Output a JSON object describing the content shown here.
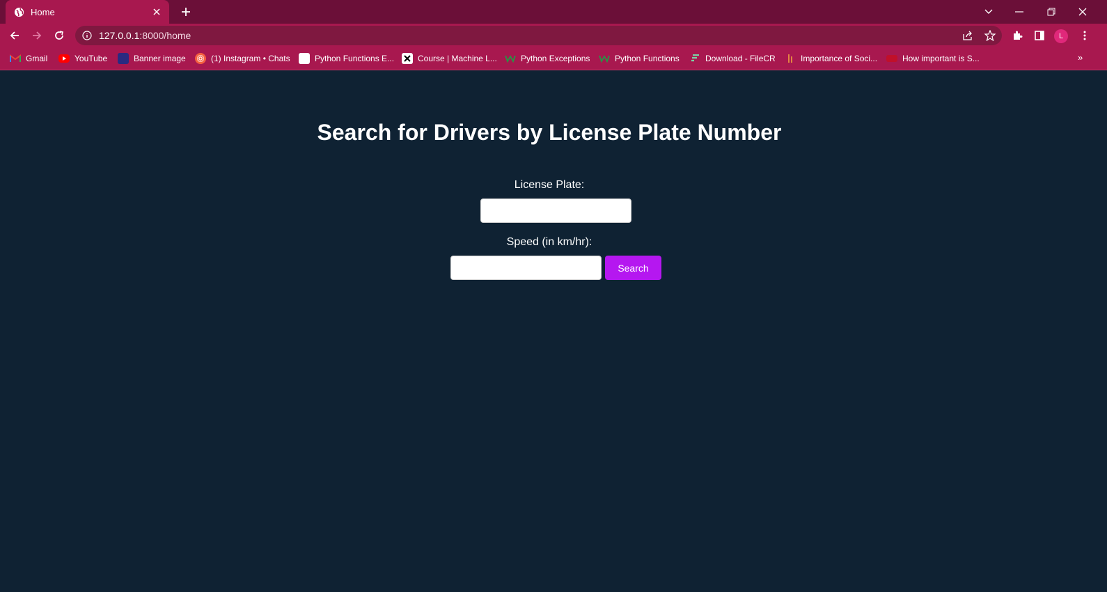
{
  "browser": {
    "tab": {
      "title": "Home"
    },
    "url": {
      "host": "127.0.0.1",
      "path": ":8000/home"
    },
    "avatar_initial": "L",
    "bookmarks": [
      {
        "label": "Gmail",
        "icon": "gmail-icon"
      },
      {
        "label": "YouTube",
        "icon": "youtube-icon"
      },
      {
        "label": "Banner image",
        "icon": "banner-icon"
      },
      {
        "label": "(1) Instagram • Chats",
        "icon": "instagram-icon"
      },
      {
        "label": "Python Functions E...",
        "icon": "python-functions-icon"
      },
      {
        "label": "Course | Machine L...",
        "icon": "x-icon"
      },
      {
        "label": "Python Exceptions",
        "icon": "w3-icon"
      },
      {
        "label": "Python Functions",
        "icon": "w3-icon"
      },
      {
        "label": "Download - FileCR",
        "icon": "filecr-icon"
      },
      {
        "label": "Importance of Soci...",
        "icon": "bar-icon"
      },
      {
        "label": "How important is S...",
        "icon": "red-site-icon"
      }
    ],
    "bookmarks_more": "»"
  },
  "page": {
    "heading": "Search for Drivers by License Plate Number",
    "license_label": "License Plate:",
    "license_value": "",
    "speed_label": "Speed (in km/hr):",
    "speed_value": "",
    "search_button": "Search"
  },
  "colors": {
    "titlebar": "#6b0f38",
    "toolbar": "#a8184f",
    "page_background": "#0f2233",
    "search_button": "#b517f0"
  }
}
